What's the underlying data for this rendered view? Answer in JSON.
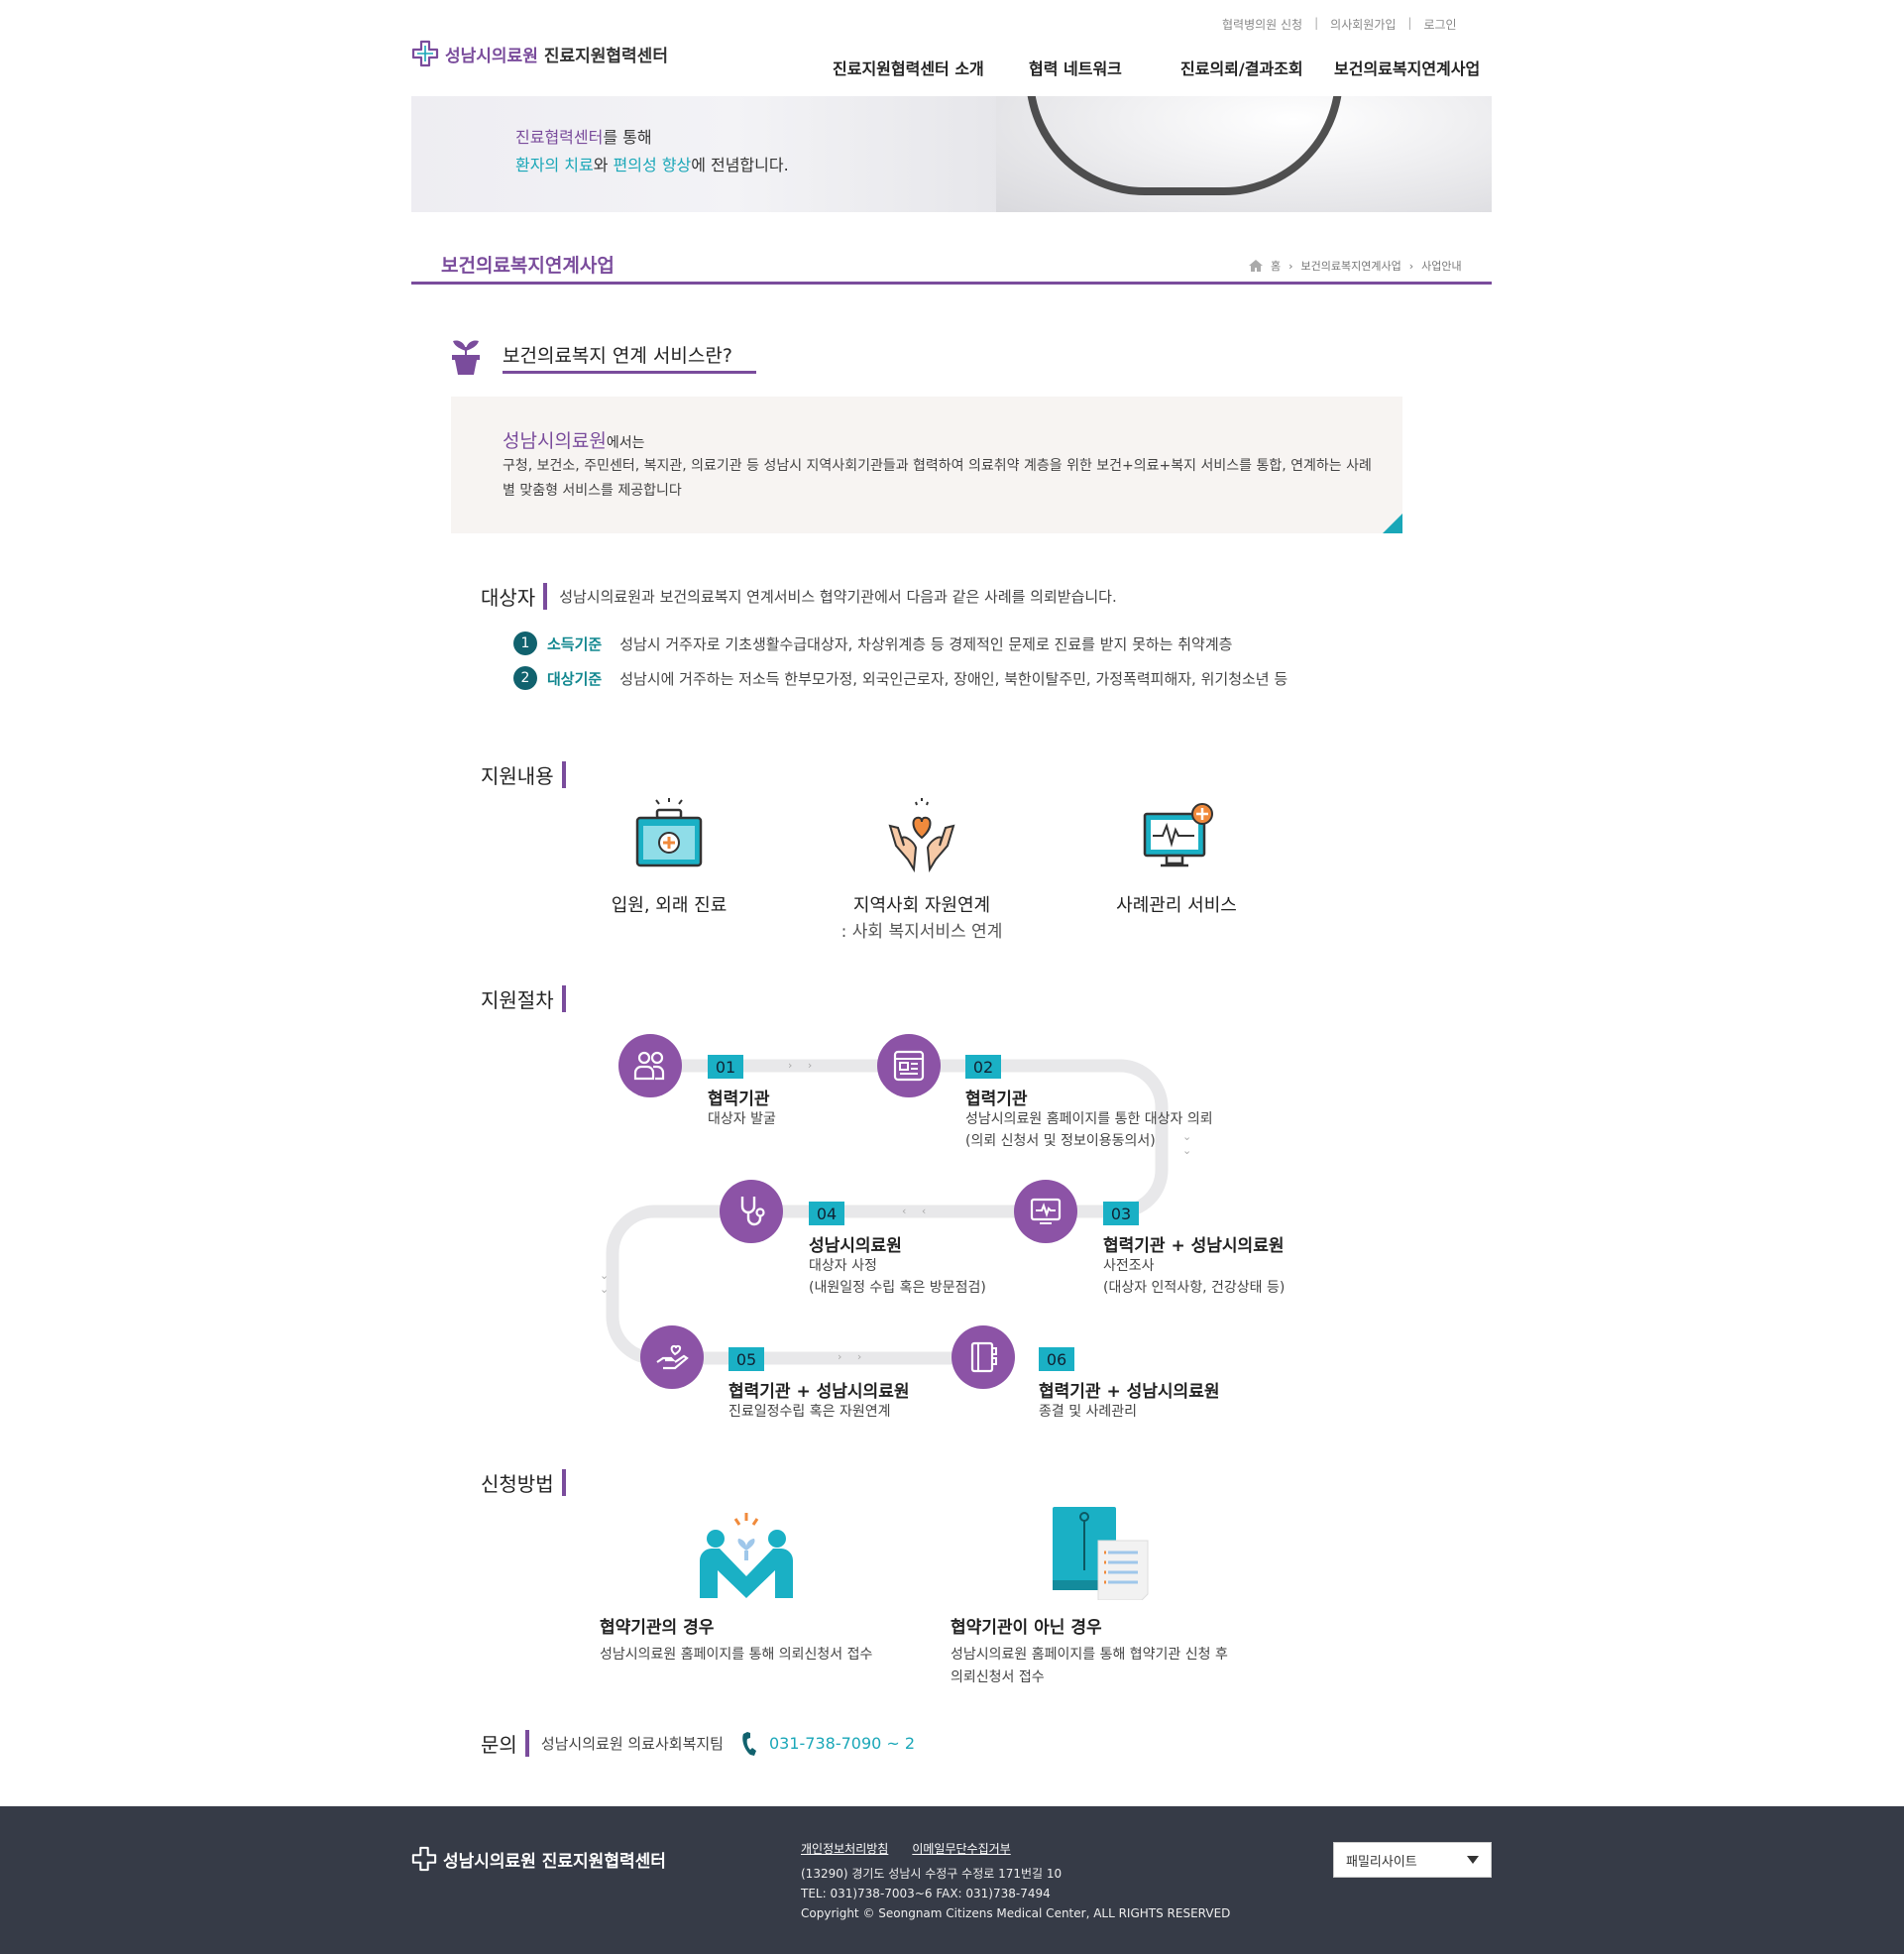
{
  "util": {
    "partner_signup": "협력병의원 신청",
    "doctor_signup": "의사회원가입",
    "login": "로그인"
  },
  "logo": {
    "main": "성남시의료원",
    "sub": "진료지원협력센터"
  },
  "gnb": [
    "진료지원협력센터 소개",
    "협력 네트워크",
    "진료의뢰/결과조회",
    "보건의료복지연계사업"
  ],
  "banner": {
    "line1_a": "진료협력센터",
    "line1_b": "를 통해",
    "line2_a": "환자의 치료",
    "line2_b": "와 ",
    "line2_c": "편의성 향상",
    "line2_d": "에 전념합니다."
  },
  "page_title": "보건의료복지연계사업",
  "breadcrumb": {
    "home": "홈",
    "level1": "보건의료복지연계사업",
    "level2": "사업안내"
  },
  "intro": {
    "title": "보건의료복지 연계 서비스란?",
    "org": "성남시의료원",
    "org_suffix": "에서는",
    "body": "구청, 보건소, 주민센터, 복지관, 의료기관 등 성남시 지역사회기관들과 협력하여 의료취약 계층을 위한 보건+의료+복지 서비스를 통합, 연계하는 사례별 맞춤형 서비스를 제공합니다"
  },
  "target": {
    "heading": "대상자",
    "desc": "성남시의료원과 보건의료복지 연계서비스 협약기관에서 다음과 같은 사례를 의뢰받습니다.",
    "criteria": [
      {
        "num": "1",
        "label": "소득기준",
        "text": "성남시 거주자로 기초생활수급대상자, 차상위계층 등 경제적인 문제로 진료를 받지 못하는 취약계층"
      },
      {
        "num": "2",
        "label": "대상기준",
        "text": "성남시에 거주하는 저소득 한부모가정, 외국인근로자, 장애인, 북한이탈주민, 가정폭력피해자, 위기청소년 등"
      }
    ]
  },
  "support": {
    "heading": "지원내용",
    "items": [
      {
        "label": "입원, 외래 진료",
        "sub": ""
      },
      {
        "label": "지역사회 자원연계",
        "sub": ": 사회 복지서비스 연계"
      },
      {
        "label": "사례관리 서비스",
        "sub": ""
      }
    ]
  },
  "process": {
    "heading": "지원절차",
    "steps": [
      {
        "num": "01",
        "org": "협력기관",
        "desc1": "대상자 발굴",
        "desc2": ""
      },
      {
        "num": "02",
        "org": "협력기관",
        "desc1": "성남시의료원 홈페이지를 통한 대상자 의뢰",
        "desc2": "(의뢰 신청서 및 정보이용동의서)"
      },
      {
        "num": "03",
        "org": "협력기관 + 성남시의료원",
        "desc1": "사전조사",
        "desc2": "(대상자 인적사항, 건강상태 등)"
      },
      {
        "num": "04",
        "org": "성남시의료원",
        "desc1": "대상자 사정",
        "desc2": "(내원일정 수립 혹은 방문점검)"
      },
      {
        "num": "05",
        "org": "협력기관 + 성남시의료원",
        "desc1": "진료일정수립 혹은 자원연계",
        "desc2": ""
      },
      {
        "num": "06",
        "org": "협력기관 + 성남시의료원",
        "desc1": "종결 및 사례관리",
        "desc2": ""
      }
    ]
  },
  "apply": {
    "heading": "신청방법",
    "items": [
      {
        "title": "협약기관의 경우",
        "desc1": "성남시의료원 홈페이지를 통해 의뢰신청서 접수",
        "desc2": ""
      },
      {
        "title": "협약기관이 아닌 경우",
        "desc1": "성남시의료원 홈페이지를 통해 협약기관 신청 후",
        "desc2": "의뢰신청서 접수"
      }
    ]
  },
  "contact": {
    "heading": "문의",
    "team": "성남시의료원 의료사회복지팀",
    "phone": "031-738-7090 ~ 2"
  },
  "footer": {
    "logo": "성남시의료원 진료지원협력센터",
    "privacy": "개인정보처리방침",
    "email_refuse": "이메일무단수집거부",
    "address": "(13290) 경기도 성남시 수정구 수정로 171번길 10",
    "tel": "TEL: 031)738-7003~6 FAX: 031)738-7494",
    "copyright": "Copyright © Seongnam Citizens Medical Center, ALL RIGHTS RESERVED",
    "family_site": "패밀리사이트"
  },
  "colors": {
    "brand_purple": "#7a4c9c",
    "accent_teal": "#1aa7b8",
    "footer_bg": "#363b47"
  }
}
